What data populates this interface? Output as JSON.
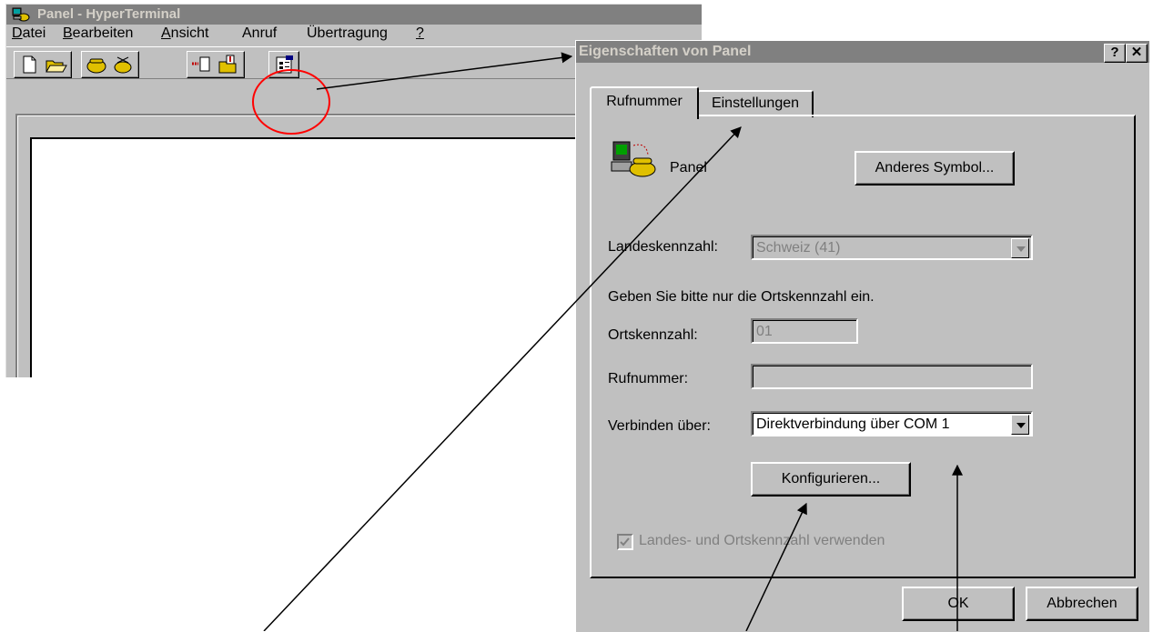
{
  "hyperterminal": {
    "title": "Panel - HyperTerminal",
    "menu": [
      "Datei",
      "Bearbeiten",
      "Ansicht",
      "Anruf",
      "Übertragung",
      "?"
    ]
  },
  "dialog": {
    "title": "Eigenschaften von Panel",
    "help_button": "?",
    "close_button": "✕",
    "tabs": [
      "Rufnummer",
      "Einstellungen"
    ],
    "connection_name": "Panel",
    "change_icon_button": "Anderes Symbol...",
    "country_code_label": "Landeskennzahl:",
    "country_code_value": "Schweiz (41)",
    "area_hint": "Geben Sie bitte nur die Ortskennzahl ein.",
    "area_code_label": "Ortskennzahl:",
    "area_code_value": "01",
    "phone_label": "Rufnummer:",
    "phone_value": "",
    "connect_via_label": "Verbinden über:",
    "connect_via_value": "Direktverbindung über COM 1",
    "configure_button": "Konfigurieren...",
    "use_codes_checkbox": "Landes- und Ortskennzahl verwenden",
    "ok_button": "OK",
    "cancel_button": "Abbrechen"
  },
  "colors": {
    "face": "#c0c0c0",
    "inactive_title": "#808080",
    "annotation": "#ff0000"
  }
}
